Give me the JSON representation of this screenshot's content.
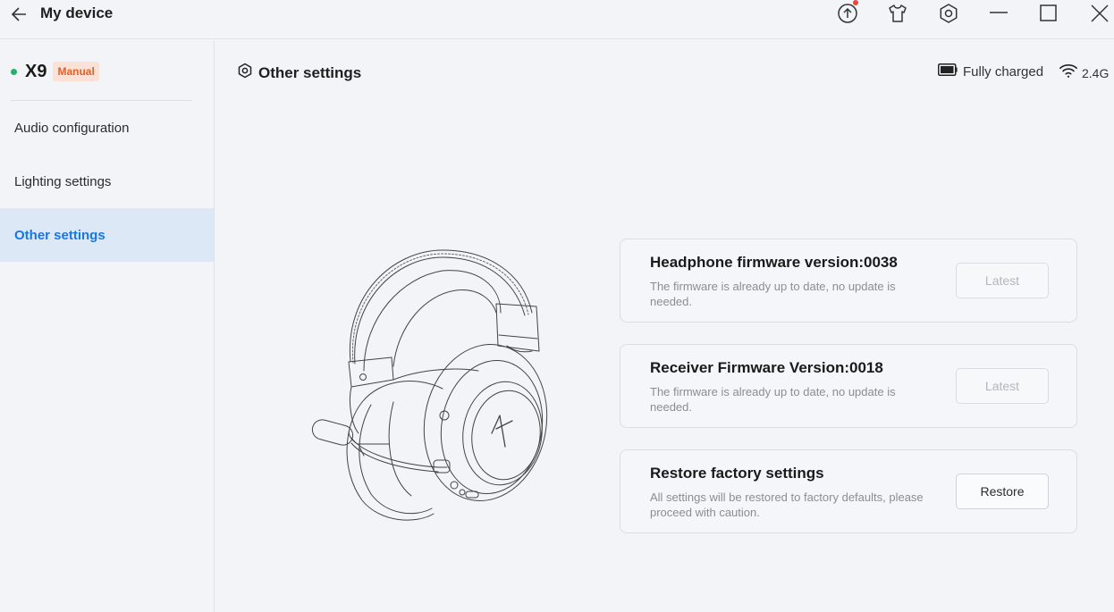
{
  "window": {
    "title": "My device",
    "icons": [
      "back-arrow-icon",
      "upload-icon",
      "shirt-icon",
      "settings-hex-icon",
      "minimize-icon",
      "maximize-icon",
      "close-icon"
    ]
  },
  "device": {
    "name": "X9",
    "badge": "Manual",
    "status_color": "#22b36b"
  },
  "sidebar": {
    "items": [
      {
        "label": "Audio configuration",
        "active": false
      },
      {
        "label": "Lighting settings",
        "active": false
      },
      {
        "label": "Other settings",
        "active": true
      }
    ]
  },
  "main": {
    "section_title": "Other settings",
    "battery_status": "Fully charged",
    "connection": "2.4G",
    "cards": [
      {
        "title": "Headphone firmware version:0038",
        "desc": "The firmware is already up to date, no update is needed.",
        "button": "Latest",
        "button_enabled": false
      },
      {
        "title": "Receiver Firmware Version:0018",
        "desc": "The firmware is already up to date, no update is needed.",
        "button": "Latest",
        "button_enabled": false
      },
      {
        "title": "Restore factory settings",
        "desc": "All settings will be restored to factory defaults, please proceed with caution.",
        "button": "Restore",
        "button_enabled": true
      }
    ]
  },
  "colors": {
    "accent": "#1677e6",
    "active_bg": "#dde8f7",
    "badge_text": "#e0632c",
    "badge_bg": "#fbe1d6",
    "notification": "#f0443a"
  }
}
